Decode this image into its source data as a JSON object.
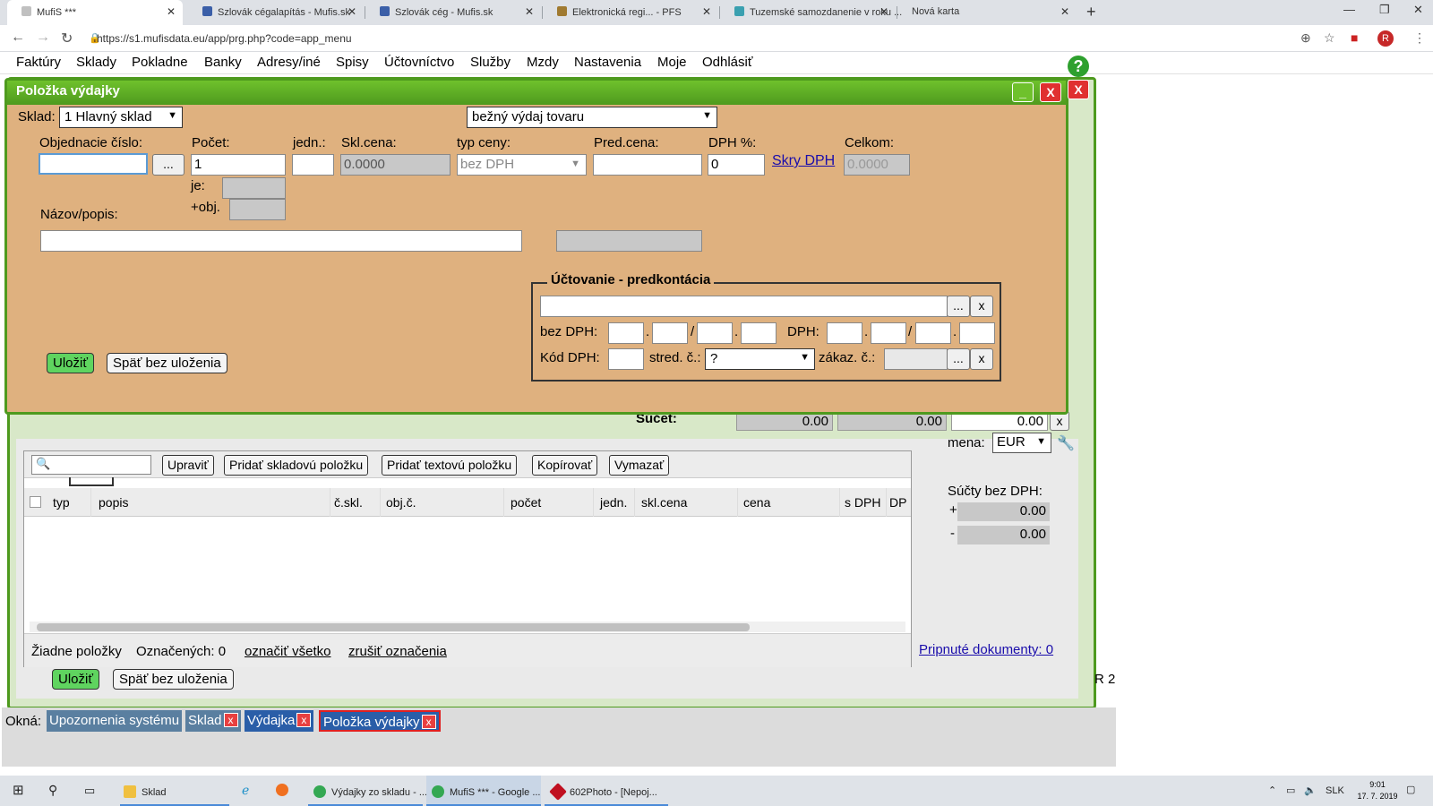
{
  "browser": {
    "tabs": [
      {
        "title": "MufiS ***",
        "active": true,
        "icon": "mufis-icon"
      },
      {
        "title": "Szlovák cégalapítás - Mufis.sk",
        "icon": "mufis-icon"
      },
      {
        "title": "Szlovák cég - Mufis.sk",
        "icon": "mufis-icon"
      },
      {
        "title": "Elektronická regi... - PFS",
        "icon": "shield-icon"
      },
      {
        "title": "Tuzemské samozdanenie v roku ...",
        "icon": "leaf-icon"
      },
      {
        "title": "Nová karta",
        "icon": ""
      }
    ],
    "url": "https://s1.mufisdata.eu/app/prg.php?code=app_menu",
    "profile_initial": "R"
  },
  "menu": [
    "Faktúry",
    "Sklady",
    "Pokladne",
    "Banky",
    "Adresy/iné",
    "Spisy",
    "Účtovníctvo",
    "Služby",
    "Mzdy",
    "Nastavenia",
    "Moje",
    "Odhlásiť"
  ],
  "dialog": {
    "title": "Položka výdajky",
    "minimize": "_",
    "close": "X",
    "outer_close": "X",
    "sklad_label": "Sklad:",
    "sklad_value": "1 Hlavný sklad",
    "type_value": "bežný výdaj tovaru",
    "labels": {
      "objednacie": "Objednacie číslo:",
      "pocet": "Počet:",
      "jedn": "jedn.:",
      "sklcena": "Skl.cena:",
      "typceny": "typ ceny:",
      "predcena": "Pred.cena:",
      "dph": "DPH %:",
      "celkom": "Celkom:",
      "je": "je:",
      "obj": "+obj.",
      "nazov": "Názov/popis:"
    },
    "values": {
      "objednacie": "",
      "pocet": "1",
      "jedn": "",
      "sklcena": "0.0000",
      "typceny": "bez DPH",
      "predcena": "",
      "dph": "0",
      "celkom": "0.0000",
      "nazov": ""
    },
    "skry_dph": "Skry DPH",
    "dots": "...",
    "ulozit": "Uložiť",
    "spat": "Späť bez uloženia",
    "uctovanie": {
      "legend": "Účtovanie - predkontácia",
      "bez_dph": "bez DPH:",
      "s_dph": "DPH:",
      "kod_dph": "Kód DPH:",
      "stred": "stred. č.:",
      "stred_value": "?",
      "zakaz": "zákaz. č.:",
      "dots": "...",
      "x": "x",
      "dot": ".",
      "slash": "/"
    }
  },
  "background": {
    "sucet": "Súčet:",
    "sums": [
      "0.00",
      "0.00",
      "0.00"
    ],
    "x": "x",
    "mena_label": "mena:",
    "mena": "EUR",
    "sucty_label": "Súčty bez DPH:",
    "plus": "+",
    "minus": "-",
    "plus_val": "0.00",
    "minus_val": "0.00",
    "toolbar": [
      "Upraviť",
      "Pridať skladovú položku",
      "Pridať textovú položku",
      "Kopírovať",
      "Vymazať"
    ],
    "columns": [
      "typ",
      "popis",
      "č.skl.",
      "obj.č.",
      "počet",
      "jedn.",
      "skl.cena",
      "cena",
      "s DPH",
      "DP"
    ],
    "footer": {
      "empty": "Žiadne položky",
      "marked": "Označených: 0",
      "mark_all": "označiť všetko",
      "unmark": "zrušiť označenia"
    },
    "pripnute": "Pripnuté dokumenty: 0",
    "r2": "R 2",
    "ulozit": "Uložiť",
    "spat": "Späť bez uloženia"
  },
  "okna": {
    "label": "Okná:",
    "items": [
      {
        "label": "Upozornenia systému",
        "color": "#5a7fa0",
        "closable": false
      },
      {
        "label": "Sklad",
        "color": "#5a7fa0",
        "closable": true
      },
      {
        "label": "Výdajka",
        "color": "#2a5ea8",
        "closable": true
      },
      {
        "label": "Položka výdajky",
        "color": "#2a5ea8",
        "closable": true,
        "active": true
      }
    ],
    "x": "x"
  },
  "taskbar": {
    "items": [
      "Sklad",
      "Výdajky zo skladu - ...",
      "MufiS *** - Google ...",
      "602Photo - [Nepoj..."
    ],
    "lang": "SLK",
    "time": "9:01",
    "date": "17. 7. 2019"
  }
}
